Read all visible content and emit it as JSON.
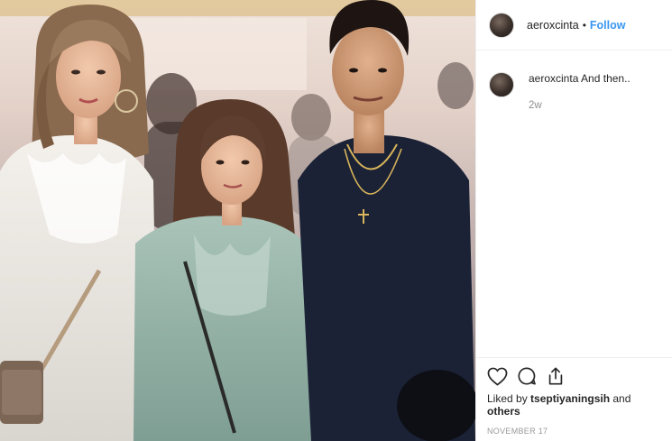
{
  "post": {
    "photo": {
      "alt": ""
    },
    "header": {
      "username": "aeroxcinta",
      "separator": "•",
      "follow_label": "Follow"
    },
    "caption": {
      "username": "aeroxcinta",
      "text": "And then..",
      "time": "2w"
    },
    "actions": {
      "like_icon": "heart-icon",
      "comment_icon": "comment-icon",
      "share_icon": "share-icon"
    },
    "likes": {
      "prefix": "Liked by ",
      "user": "tseptiyaningsih",
      "connector": " and ",
      "others": "others"
    },
    "date": "NOVEMBER 17"
  },
  "colors": {
    "link": "#3897f0",
    "text": "#262626",
    "muted": "#8e8e8e",
    "border": "#efefef"
  }
}
